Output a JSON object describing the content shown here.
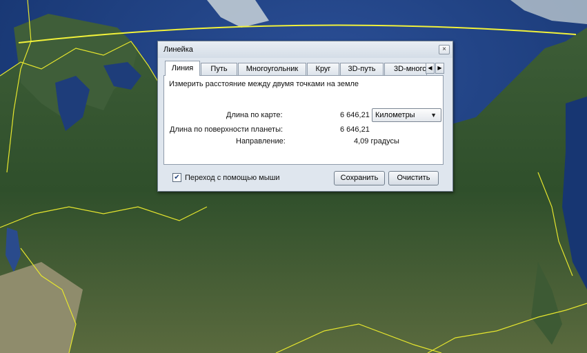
{
  "dialog": {
    "title": "Линейка",
    "close_glyph": "×",
    "tabs": [
      "Линия",
      "Путь",
      "Многоугольник",
      "Круг",
      "3D-путь",
      "3D-много"
    ],
    "tab_scroll_left": "◀",
    "tab_scroll_right": "▶",
    "description": "Измерить расстояние между двумя точками на земле",
    "map_length_label": "Длина по карте:",
    "map_length_value": "6 646,21",
    "units_selected": "Километры",
    "surface_length_label": "Длина по поверхности планеты:",
    "surface_length_value": "6 646,21",
    "direction_label": "Направление:",
    "direction_value": "4,09 градусы",
    "mouse_nav_label": "Переход с помощью мыши",
    "mouse_nav_checked": true,
    "save_label": "Сохранить",
    "clear_label": "Очистить"
  },
  "icons": {
    "close": "close-icon",
    "dropdown": "chevron-down-icon",
    "checkbox": "checkmark-icon"
  },
  "colors": {
    "measure_line": "#f2f23a",
    "border_line": "#e6e62e",
    "dialog_bg": "#dfe6ee"
  }
}
